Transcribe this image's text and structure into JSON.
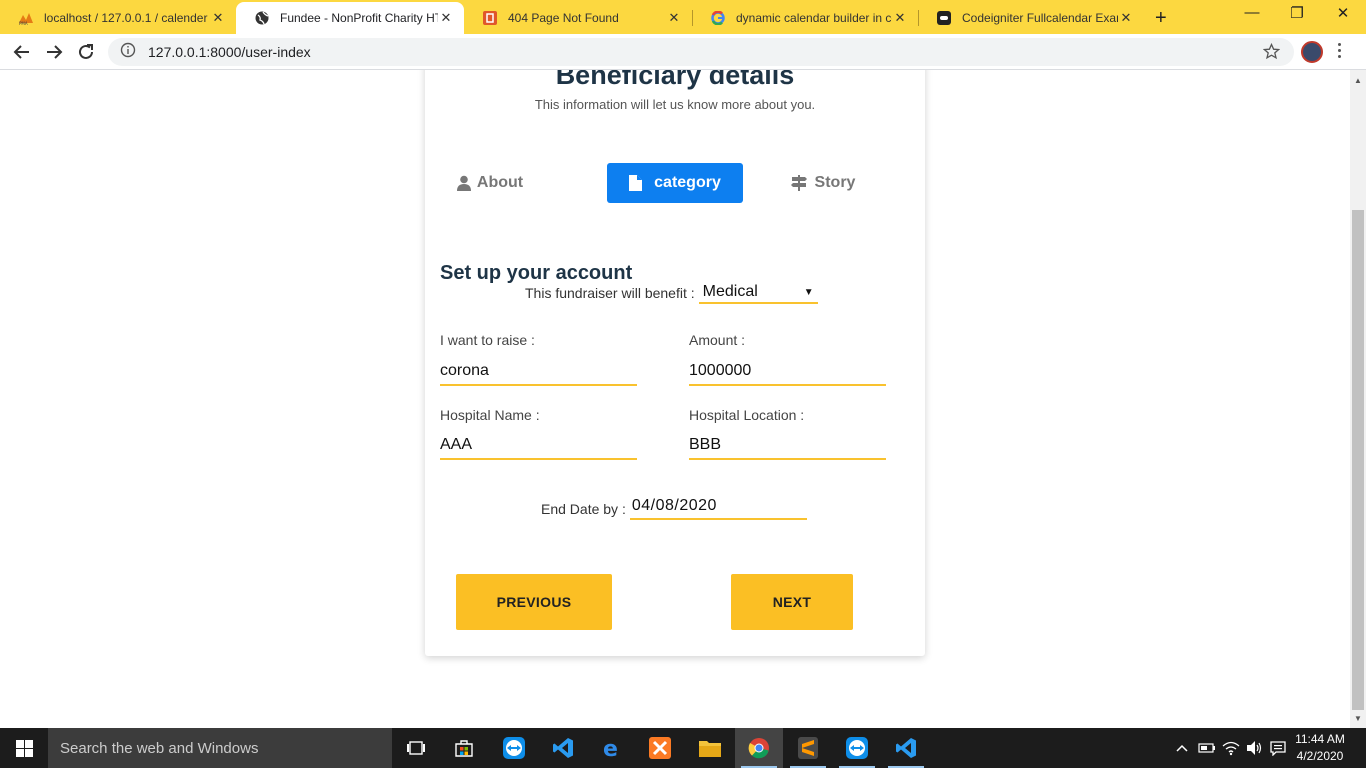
{
  "browser": {
    "tabs": [
      {
        "title": "localhost / 127.0.0.1 / calender",
        "favicon": "phpmyadmin-icon"
      },
      {
        "title": "Fundee - NonProfit Charity HTML",
        "favicon": "globe-icon"
      },
      {
        "title": "404 Page Not Found",
        "favicon": "codeigniter-icon"
      },
      {
        "title": "dynamic calendar builder in co",
        "favicon": "google-icon"
      },
      {
        "title": "Codeigniter Fullcalendar Examp",
        "favicon": "site-icon"
      }
    ],
    "url": "127.0.0.1:8000/user-index"
  },
  "page": {
    "title": "Beneficiary details",
    "subtitle": "This information will let us know more about you.",
    "steps": [
      {
        "label": "About"
      },
      {
        "label": "category"
      },
      {
        "label": "Story"
      }
    ],
    "section_title": "Set up your account",
    "benefit": {
      "label": "This fundraiser will benefit :",
      "value": "Medical"
    },
    "fields": {
      "raise": {
        "label": "I want to raise :",
        "value": "corona"
      },
      "amount": {
        "label": "Amount :",
        "value": "1000000"
      },
      "hospital_name": {
        "label": "Hospital Name :",
        "value": "AAA"
      },
      "hospital_location": {
        "label": "Hospital Location :",
        "value": "BBB"
      }
    },
    "end_date": {
      "label": "End Date by :",
      "value": "04/08/2020"
    },
    "buttons": {
      "previous": "PREVIOUS",
      "next": "NEXT"
    }
  },
  "taskbar": {
    "search_placeholder": "Search the web and Windows",
    "time": "11:44 AM",
    "date": "4/2/2020"
  },
  "colors": {
    "tabstrip": "#fcd840",
    "accent_blue": "#0d7ff0",
    "accent_yellow": "#fbbf24",
    "heading": "#1e3446"
  }
}
